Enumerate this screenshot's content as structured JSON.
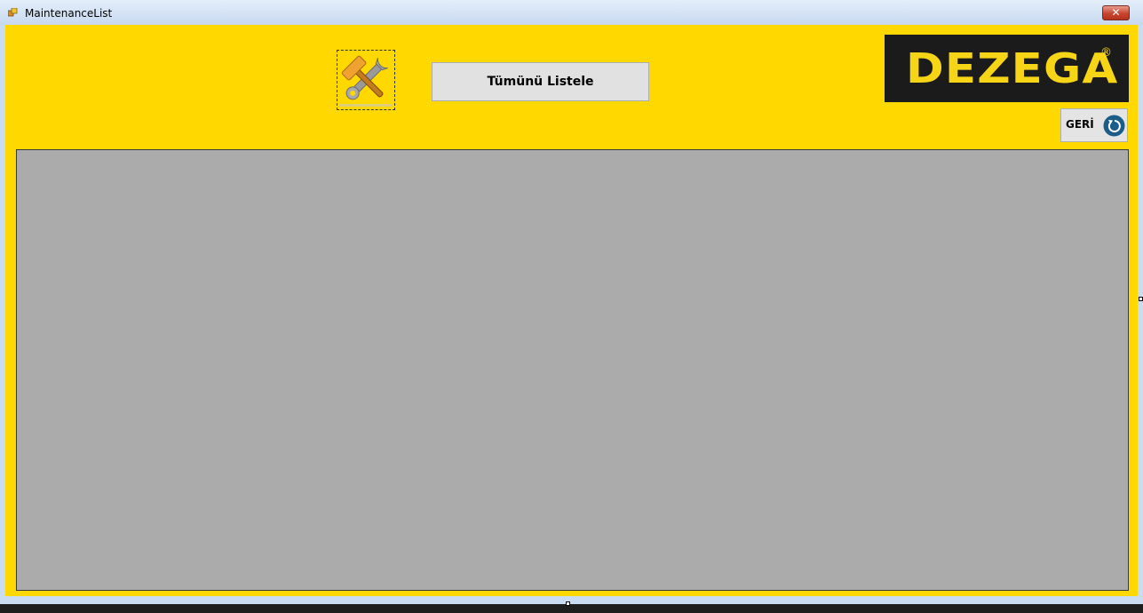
{
  "window": {
    "title": "MaintenanceList"
  },
  "toolbar": {
    "list_all_label": "Tümünü Listele",
    "back_label": "GERİ"
  },
  "logo": {
    "text": "DEZEGA",
    "registered_mark": "®"
  },
  "icons": {
    "app": "form-icon",
    "tools": "wrench-hammer-icon",
    "back": "refresh-arrow-icon",
    "close": "close-icon"
  },
  "colors": {
    "form_background": "#ffd800",
    "grid_background": "#ababab",
    "logo_background": "#1b1b1b",
    "logo_text": "#f5d515",
    "back_icon": "#1a5c8a"
  }
}
